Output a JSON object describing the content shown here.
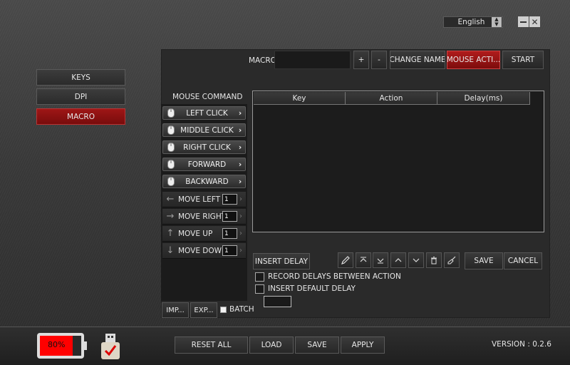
{
  "header": {
    "language": "English",
    "minimize_icon": "minimize-icon",
    "close_icon": "close-icon"
  },
  "sidebar": {
    "items": [
      {
        "label": "KEYS",
        "active": false
      },
      {
        "label": "DPI",
        "active": false
      },
      {
        "label": "MACRO",
        "active": true
      }
    ]
  },
  "macro_bar": {
    "label": "MACRO",
    "name_value": "",
    "plus_label": "+",
    "minus_label": "-",
    "change_name_label": "CHANGE NAME",
    "mouse_action_label": "MOUSE ACTI...",
    "start_label": "START"
  },
  "mouse_command": {
    "title": "MOUSE COMMAND",
    "buttons": [
      {
        "label": "LEFT CLICK"
      },
      {
        "label": "MIDDLE CLICK"
      },
      {
        "label": "RIGHT CLICK"
      },
      {
        "label": "FORWARD"
      },
      {
        "label": "BACKWARD"
      }
    ],
    "moves": [
      {
        "label": "MOVE LEFT",
        "arrow": "←",
        "value": "1"
      },
      {
        "label": "MOVE RIGHT",
        "arrow": "→",
        "value": "1"
      },
      {
        "label": "MOVE UP",
        "arrow": "↑",
        "value": "1"
      },
      {
        "label": "MOVE DOWN",
        "arrow": "↓",
        "value": "1"
      }
    ],
    "import_label": "IMP...",
    "export_label": "EXP...",
    "batch_label": "BATCH"
  },
  "table": {
    "columns": [
      "Key",
      "Action",
      "Delay(ms)"
    ],
    "rows": []
  },
  "editor": {
    "insert_delay_label": "INSERT DELAY",
    "save_label": "SAVE",
    "cancel_label": "CANCEL",
    "record_delays_label": "RECORD DELAYS BETWEEN ACTION",
    "insert_default_delay_label": "INSERT DEFAULT DELAY",
    "default_delay_value": ""
  },
  "footer": {
    "battery_percent": "80%",
    "battery_level": 0.8,
    "reset_all_label": "RESET ALL",
    "load_label": "LOAD",
    "save_label": "SAVE",
    "apply_label": "APPLY",
    "version": "VERSION : 0.2.6"
  },
  "colors": {
    "accent_red": "#9e1616",
    "battery_red": "#ff0000"
  }
}
